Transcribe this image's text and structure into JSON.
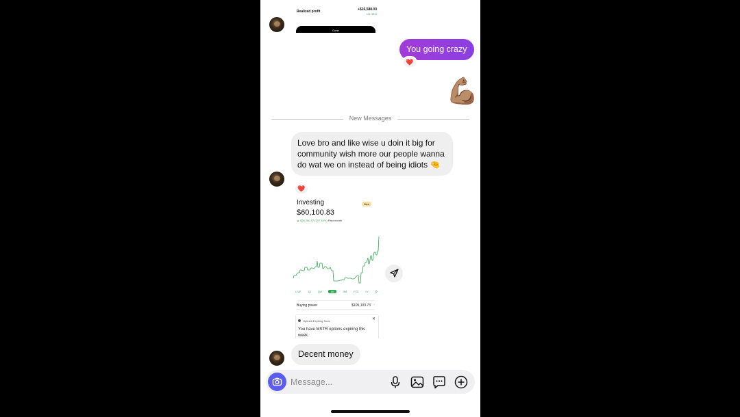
{
  "shared_top": {
    "label": "Realized profit",
    "value": "+$16,588.00",
    "percent": "+41.32%",
    "done_label": "Done"
  },
  "outgoing": {
    "text": "You going crazy",
    "reaction": "❤️",
    "sticker": "💪🏽"
  },
  "divider": {
    "label": "New Messages"
  },
  "incoming_1": {
    "text": "Love bro and like wise u doin it big for community wish more our people wanna do wat we on instead of being idiots 🤏",
    "reaction": "❤️"
  },
  "shared_chart": {
    "title": "Investing",
    "badge": "New",
    "balance": "$60,100.83",
    "change": "▲ $26,780.97 (107.16%)",
    "change_period": "Past month",
    "ranges": [
      "LIVE",
      "1D",
      "1W",
      "1M",
      "3M",
      "YTD",
      "1Y",
      "⚙"
    ],
    "selected_range": "1M",
    "buying_power_label": "Buying power",
    "buying_power_value": "$105,103.73",
    "options_header": "Options Expiring Soon",
    "options_body": "You have MSTR options expiring this week.",
    "color": "#2fa84f"
  },
  "incoming_2": {
    "text": "Decent money"
  },
  "composer": {
    "placeholder": "Message..."
  },
  "icons": {
    "camera": "camera-icon",
    "mic": "microphone-icon",
    "gallery": "gallery-icon",
    "sticker": "sticker-icon",
    "plus": "plus-icon",
    "share": "share-icon"
  },
  "colors": {
    "outgoing_bubble": "#9b3ddc",
    "incoming_bubble": "#efefef",
    "camera_button": "#5b5cf0",
    "reaction_heart": "#e0245e"
  }
}
